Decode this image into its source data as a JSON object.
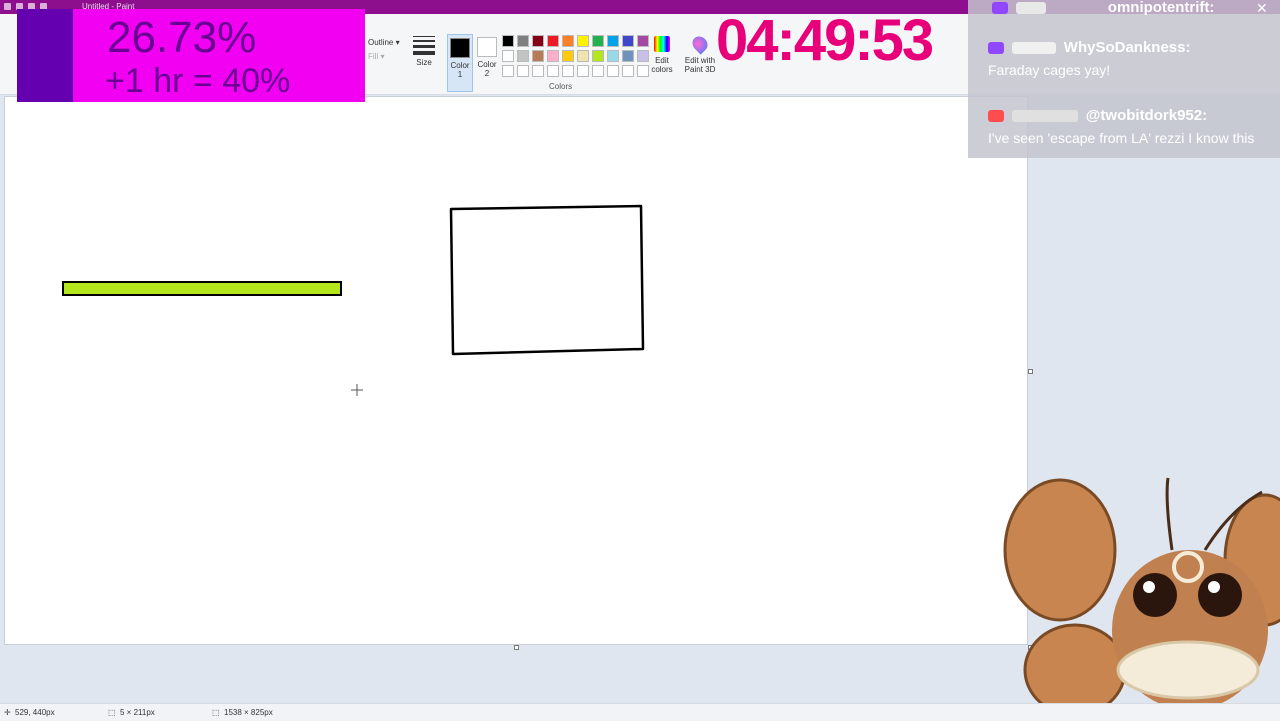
{
  "window": {
    "title": "Untitled - Paint"
  },
  "ribbon": {
    "outline_label": "Outline ▾",
    "fill_label": "Fill ▾",
    "size_label": "Size",
    "color1_label": "Color 1",
    "color2_label": "Color 2",
    "colors_group_label": "Colors",
    "edit_colors_label": "Edit colors",
    "edit_paint3d_label": "Edit with Paint 3D",
    "color1_value": "#000000",
    "color2_value": "#ffffff",
    "palette": [
      "#000000",
      "#7f7f7f",
      "#880015",
      "#ed1c24",
      "#ff7f27",
      "#fff200",
      "#22b14c",
      "#00a2e8",
      "#3f48cc",
      "#a349a4",
      "#ffffff",
      "#c3c3c3",
      "#b97a57",
      "#ffaec9",
      "#ffc90e",
      "#efe4b0",
      "#b5e61d",
      "#99d9ea",
      "#7092be",
      "#c8bfe7",
      "#ffffff",
      "#ffffff",
      "#ffffff",
      "#ffffff",
      "#ffffff",
      "#ffffff",
      "#ffffff",
      "#ffffff",
      "#ffffff",
      "#ffffff"
    ]
  },
  "overlay": {
    "progress_percent": "26.73%",
    "progress_note": "+1 hr = 40%",
    "timer": "04:49:53"
  },
  "chat": {
    "top_user": "omnipotentrift:",
    "messages": [
      {
        "user": "WhySoDankness:",
        "text": "Faraday cages yay!"
      },
      {
        "user": "@twobitdork952:",
        "text": "I've seen 'escape from LA' rezzi I know this"
      }
    ]
  },
  "status": {
    "cursor_pos": "529, 440px",
    "selection_size": "5 × 211px",
    "canvas_size": "1538 × 825px"
  },
  "colors": {
    "bar_fill": "#b5e61d",
    "stroke": "#000000"
  }
}
